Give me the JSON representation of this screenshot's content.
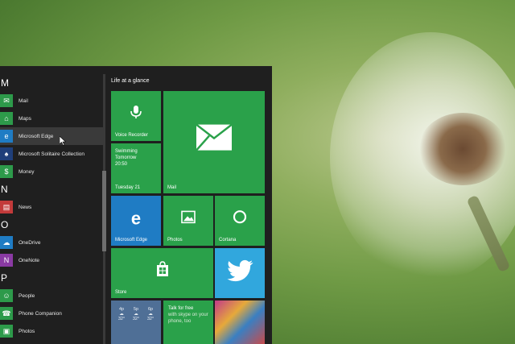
{
  "start_menu": {
    "app_list": [
      {
        "type": "letter",
        "text": "M"
      },
      {
        "type": "app",
        "label": "Mail",
        "icon": "mail-icon",
        "glyph": "✉"
      },
      {
        "type": "app",
        "label": "Maps",
        "icon": "maps-icon",
        "glyph": "⌂"
      },
      {
        "type": "app",
        "label": "Microsoft Edge",
        "icon": "edge-icon",
        "glyph": "e",
        "selected": true
      },
      {
        "type": "app",
        "label": "Microsoft Solitaire Collection",
        "icon": "solitaire-icon",
        "glyph": "♠"
      },
      {
        "type": "app",
        "label": "Money",
        "icon": "money-icon",
        "glyph": "$"
      },
      {
        "type": "letter",
        "text": "N"
      },
      {
        "type": "app",
        "label": "News",
        "icon": "news-icon",
        "glyph": "▤"
      },
      {
        "type": "letter",
        "text": "O"
      },
      {
        "type": "app",
        "label": "OneDrive",
        "icon": "onedrive-icon",
        "glyph": "☁"
      },
      {
        "type": "app",
        "label": "OneNote",
        "icon": "onenote-icon",
        "glyph": "N"
      },
      {
        "type": "letter",
        "text": "P"
      },
      {
        "type": "app",
        "label": "People",
        "icon": "people-icon",
        "glyph": "☺"
      },
      {
        "type": "app",
        "label": "Phone Companion",
        "icon": "phone-icon",
        "glyph": "☎"
      },
      {
        "type": "app",
        "label": "Photos",
        "icon": "photos-icon",
        "glyph": "▣"
      }
    ],
    "tiles_header": "Life at a glance",
    "tiles": {
      "voice_recorder": "Voice Recorder",
      "calendar": {
        "line1": "Swimming",
        "line2": "Tomorrow",
        "line3": "20:50",
        "date": "Tuesday 21"
      },
      "mail": "Mail",
      "edge": "Microsoft Edge",
      "photos": "Photos",
      "cortana": "Cortana",
      "store": "Store",
      "skype": {
        "title": "Talk for free",
        "sub": "with skype on your phone, too"
      },
      "weather": [
        {
          "day": "4p",
          "temp": "32°"
        },
        {
          "day": "5p",
          "temp": "32°"
        },
        {
          "day": "6p",
          "temp": "32°"
        }
      ]
    }
  },
  "colors": {
    "tile_green": "#2aa14a",
    "tile_blue": "#1f7cc4",
    "twitter_blue": "#31a7dd",
    "menu_bg": "#1f1f1f"
  }
}
